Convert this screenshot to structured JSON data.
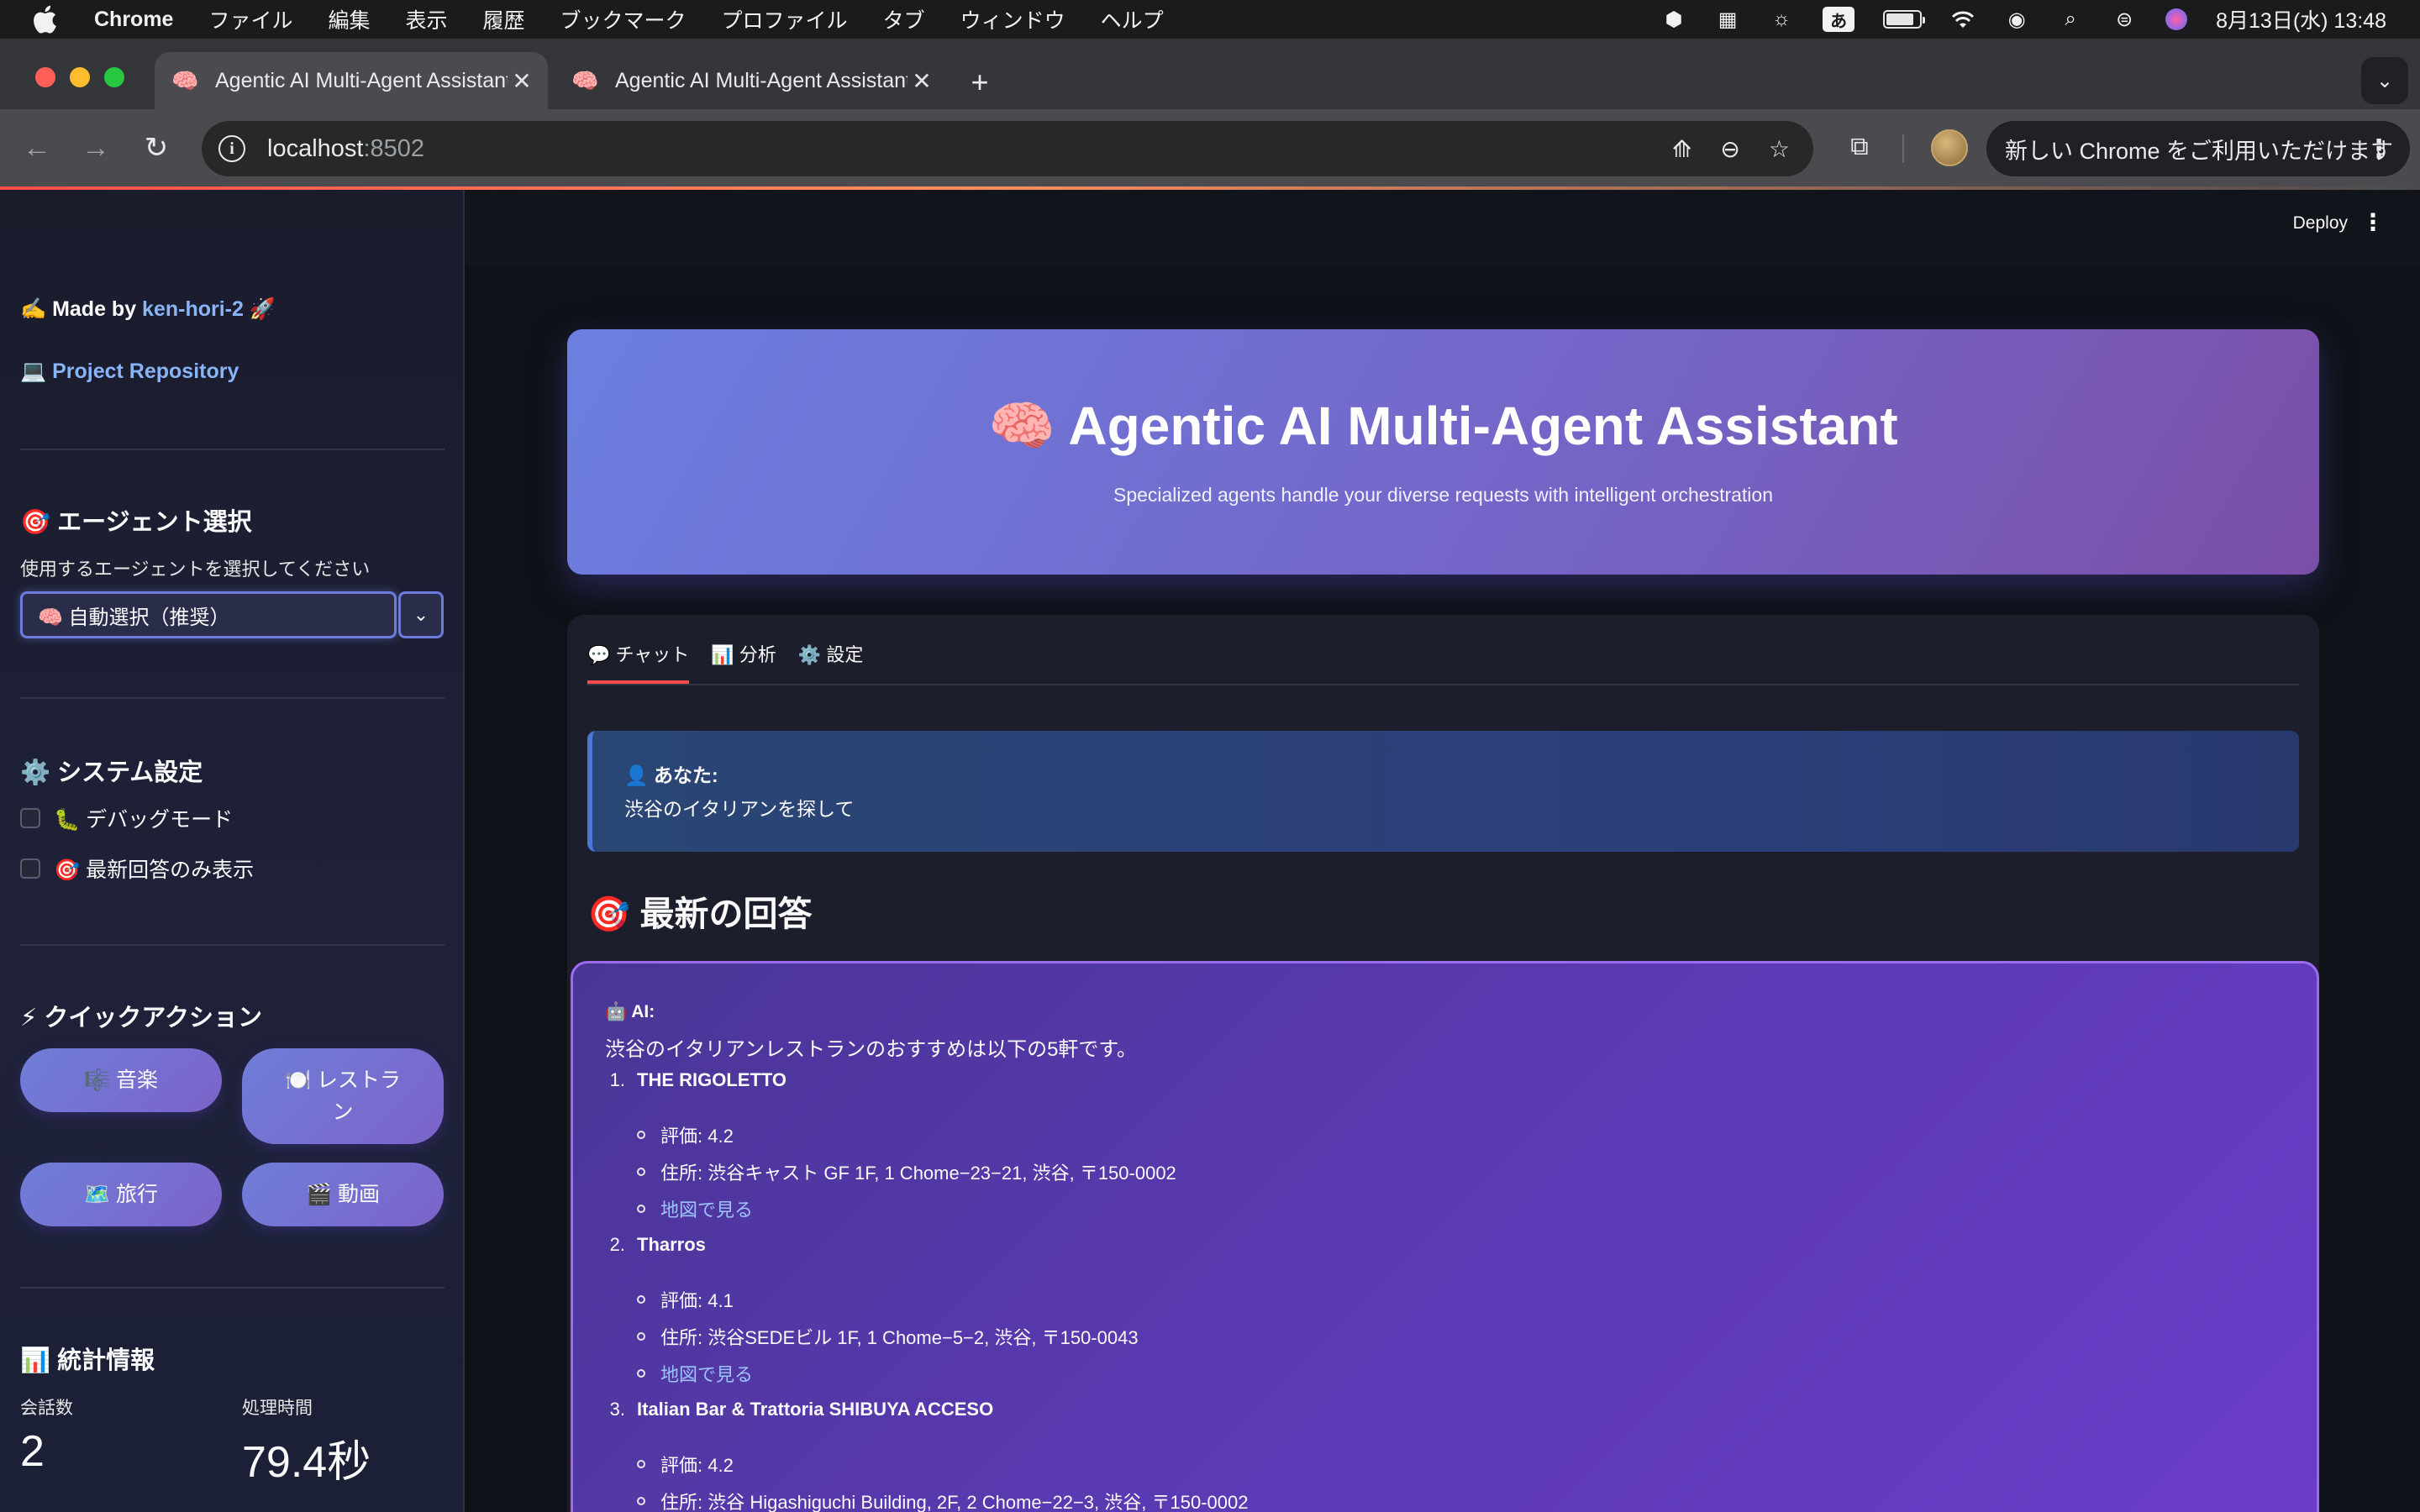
{
  "menubar": {
    "app_name": "Chrome",
    "items": [
      "ファイル",
      "編集",
      "表示",
      "履歴",
      "ブックマーク",
      "プロファイル",
      "タブ",
      "ウィンドウ",
      "ヘルプ"
    ],
    "ime": "あ",
    "clock": "8月13日(水)  13:48",
    "battery_level": 0.85
  },
  "browser": {
    "tabs": [
      {
        "title": "Agentic AI Multi-Agent Assistant",
        "favicon": "brain-icon"
      },
      {
        "title": "Agentic AI Multi-Agent Assistant",
        "favicon": "brain-icon"
      }
    ],
    "url_host": "localhost",
    "url_port": ":8502",
    "update_text": "新しい Chrome をご利用いただけます"
  },
  "app": {
    "deploy_label": "Deploy",
    "sidebar": {
      "made_by_prefix": "✍️ Made by ",
      "made_by_link": "ken-hori-2",
      "made_by_suffix": " 🚀",
      "repo_emoji": "💻",
      "repo_label": "Project Repository",
      "agent_heading": "🎯 エージェント選択",
      "agent_label": "使用するエージェントを選択してください",
      "agent_selected": "🧠 自動選択（推奨）",
      "system_heading": "⚙️ システム設定",
      "debug_label": "🐛 デバッグモード",
      "latest_only_label": "🎯 最新回答のみ表示",
      "quick_heading": "⚡ クイックアクション",
      "quick_actions": {
        "music": "🎼 音楽",
        "restaurant": "🍽️ レストラン",
        "travel": "🗺️ 旅行",
        "video": "🎬 動画"
      },
      "stats_heading": "📊 統計情報",
      "stats": {
        "conversations_label": "会話数",
        "conversations_value": "2",
        "time_label": "処理時間",
        "time_value": "79.4秒"
      }
    },
    "hero": {
      "title": "🧠 Agentic AI Multi-Agent Assistant",
      "subtitle": "Specialized agents handle your diverse requests with intelligent orchestration"
    },
    "tabs": [
      "💬 チャット",
      "📊 分析",
      "⚙️ 設定"
    ],
    "user_message": {
      "who": "👤 あなた:",
      "text": "渋谷のイタリアンを探して"
    },
    "latest_heading": "🎯 最新の回答",
    "ai_message": {
      "who": "🤖 AI:",
      "intro": "渋谷のイタリアンレストランのおすすめは以下の5軒です。",
      "restaurants": [
        {
          "num": "1.",
          "name": "THE RIGOLETTO",
          "rating": "評価: 4.2",
          "address": "住所: 渋谷キャスト GF 1F, 1 Chome−23−21, 渋谷, 〒150-0002",
          "map": "地図で見る"
        },
        {
          "num": "2.",
          "name": "Tharros",
          "rating": "評価: 4.1",
          "address": "住所: 渋谷SEDEビル 1F, 1 Chome−5−2, 渋谷, 〒150-0043",
          "map": "地図で見る"
        },
        {
          "num": "3.",
          "name": "Italian Bar & Trattoria SHIBUYA ACCESO",
          "rating": "評価: 4.2",
          "address": "住所: 渋谷 Higashiguchi Building, 2F, 2 Chome−22−3, 渋谷, 〒150-0002"
        }
      ]
    }
  }
}
